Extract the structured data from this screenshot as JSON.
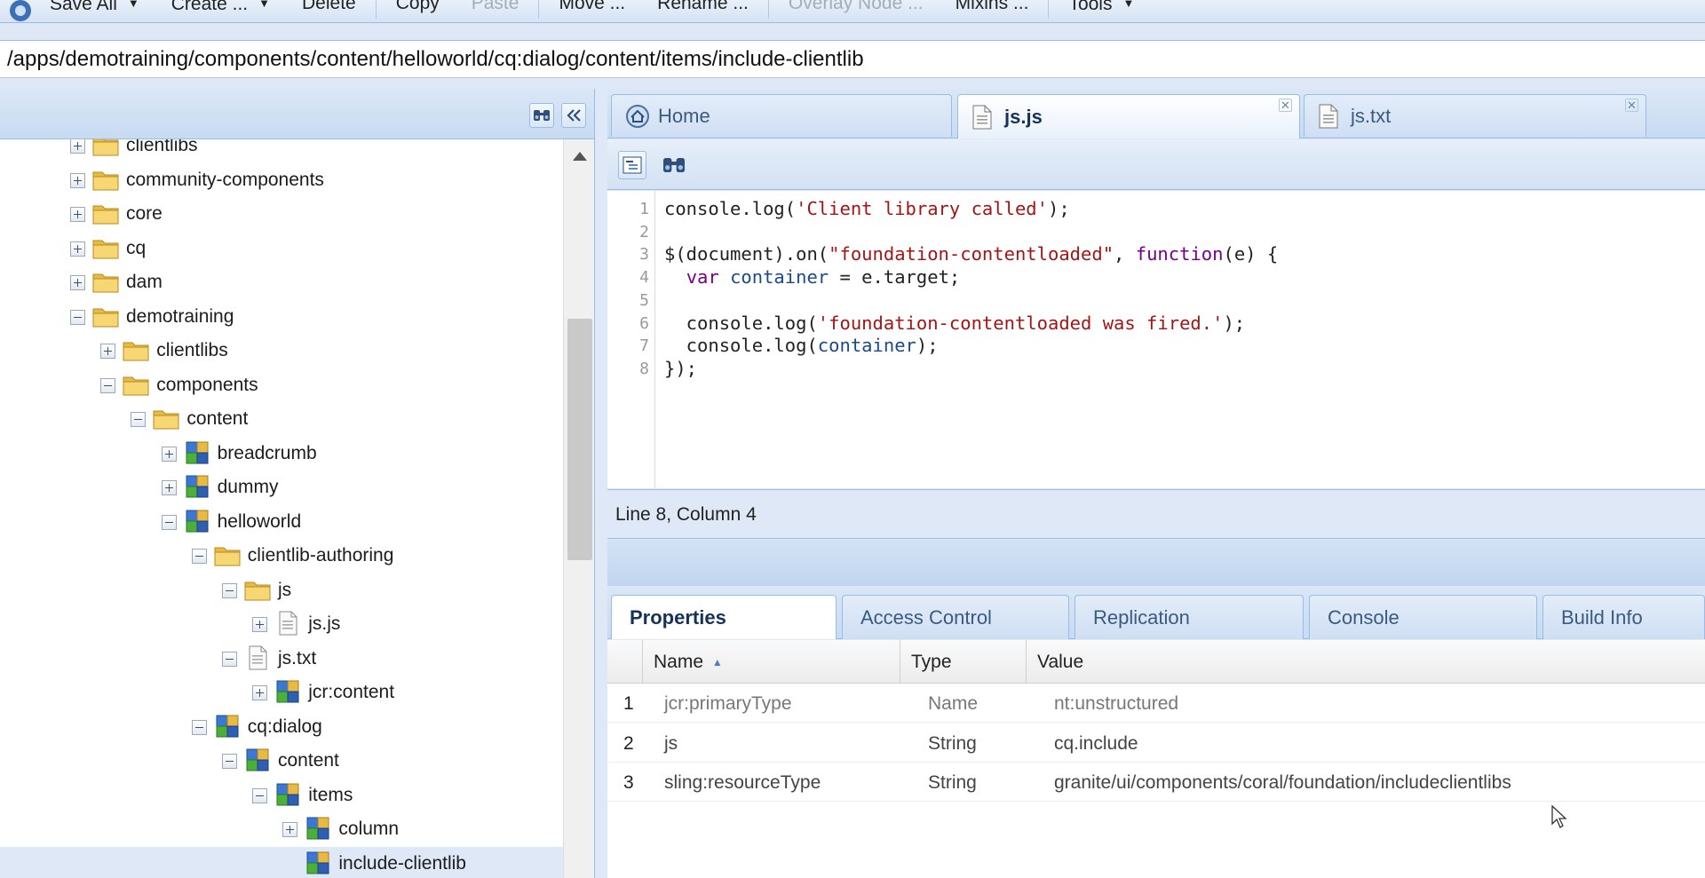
{
  "toolbar": {
    "buttons": [
      {
        "label": "Save All",
        "dropdown": true,
        "disabled": false
      },
      {
        "label": "Create ...",
        "dropdown": true,
        "disabled": false
      },
      {
        "label": "Delete",
        "dropdown": false,
        "disabled": false
      },
      {
        "label": "Copy",
        "dropdown": false,
        "disabled": false
      },
      {
        "label": "Paste",
        "dropdown": false,
        "disabled": true
      },
      {
        "label": "Move ...",
        "dropdown": false,
        "disabled": false
      },
      {
        "label": "Rename ...",
        "dropdown": false,
        "disabled": false
      },
      {
        "label": "Overlay Node ...",
        "dropdown": false,
        "disabled": true
      },
      {
        "label": "Mixins ...",
        "dropdown": false,
        "disabled": false
      },
      {
        "label": "Tools",
        "dropdown": true,
        "disabled": false
      }
    ]
  },
  "path": {
    "value": "/apps/demotraining/components/content/helloworld/cq:dialog/content/items/include-clientlib"
  },
  "tree": {
    "nodes": [
      {
        "label": "clientlibs",
        "depth": 0,
        "expander": "plus",
        "icon": "folder"
      },
      {
        "label": "community-components",
        "depth": 0,
        "expander": "plus",
        "icon": "folder"
      },
      {
        "label": "core",
        "depth": 0,
        "expander": "plus",
        "icon": "folder"
      },
      {
        "label": "cq",
        "depth": 0,
        "expander": "plus",
        "icon": "folder"
      },
      {
        "label": "dam",
        "depth": 0,
        "expander": "plus",
        "icon": "folder"
      },
      {
        "label": "demotraining",
        "depth": 0,
        "expander": "minus",
        "icon": "folder"
      },
      {
        "label": "clientlibs",
        "depth": 1,
        "expander": "plus",
        "icon": "folder"
      },
      {
        "label": "components",
        "depth": 1,
        "expander": "minus",
        "icon": "folder"
      },
      {
        "label": "content",
        "depth": 2,
        "expander": "minus",
        "icon": "folder"
      },
      {
        "label": "breadcrumb",
        "depth": 3,
        "expander": "plus",
        "icon": "component"
      },
      {
        "label": "dummy",
        "depth": 3,
        "expander": "plus",
        "icon": "component"
      },
      {
        "label": "helloworld",
        "depth": 3,
        "expander": "minus",
        "icon": "component"
      },
      {
        "label": "clientlib-authoring",
        "depth": 4,
        "expander": "minus",
        "icon": "folder"
      },
      {
        "label": "js",
        "depth": 5,
        "expander": "minus",
        "icon": "folder"
      },
      {
        "label": "js.js",
        "depth": 6,
        "expander": "plus",
        "icon": "file"
      },
      {
        "label": "js.txt",
        "depth": 5,
        "expander": "minus",
        "icon": "file"
      },
      {
        "label": "jcr:content",
        "depth": 6,
        "expander": "plus",
        "icon": "component"
      },
      {
        "label": "cq:dialog",
        "depth": 4,
        "expander": "minus",
        "icon": "component"
      },
      {
        "label": "content",
        "depth": 5,
        "expander": "minus",
        "icon": "component"
      },
      {
        "label": "items",
        "depth": 6,
        "expander": "minus",
        "icon": "component"
      },
      {
        "label": "column",
        "depth": 7,
        "expander": "plus",
        "icon": "component"
      },
      {
        "label": "include-clientlib",
        "depth": 7,
        "expander": "none",
        "icon": "component",
        "selected": true
      }
    ]
  },
  "editor": {
    "tabs": [
      {
        "label": "Home",
        "icon": "home-icon",
        "closable": false,
        "active": false
      },
      {
        "label": "js.js",
        "icon": "file-icon",
        "closable": true,
        "active": true
      },
      {
        "label": "js.txt",
        "icon": "file-icon",
        "closable": true,
        "active": false
      }
    ],
    "code": [
      [
        {
          "t": "console.log("
        },
        {
          "t": "'Client library called'",
          "c": "str"
        },
        {
          "t": ");"
        }
      ],
      [],
      [
        {
          "t": "$(document).on("
        },
        {
          "t": "\"foundation-contentloaded\"",
          "c": "str"
        },
        {
          "t": ", "
        },
        {
          "t": "function",
          "c": "kw"
        },
        {
          "t": "(e) {"
        }
      ],
      [
        {
          "t": "  "
        },
        {
          "t": "var",
          "c": "kw"
        },
        {
          "t": " "
        },
        {
          "t": "container",
          "c": "var"
        },
        {
          "t": " = e.target;"
        }
      ],
      [],
      [
        {
          "t": "  console.log("
        },
        {
          "t": "'foundation-contentloaded was fired.'",
          "c": "str"
        },
        {
          "t": ");"
        }
      ],
      [
        {
          "t": "  console.log("
        },
        {
          "t": "container",
          "c": "var"
        },
        {
          "t": ");"
        }
      ],
      [
        {
          "t": "});"
        }
      ]
    ],
    "status": "Line 8, Column 4"
  },
  "bottom": {
    "tabs": [
      {
        "label": "Properties",
        "active": true
      },
      {
        "label": "Access Control",
        "active": false
      },
      {
        "label": "Replication",
        "active": false
      },
      {
        "label": "Console",
        "active": false
      },
      {
        "label": "Build Info",
        "active": false
      }
    ],
    "grid": {
      "headers": {
        "name": "Name",
        "type": "Type",
        "value": "Value"
      },
      "sort_indicator": "▲",
      "rows": [
        {
          "num": "1",
          "name": "jcr:primaryType",
          "type": "Name",
          "value": "nt:unstructured",
          "dim": true
        },
        {
          "num": "2",
          "name": "js",
          "type": "String",
          "value": "cq.include",
          "dim": false
        },
        {
          "num": "3",
          "name": "sling:resourceType",
          "type": "String",
          "value": "granite/ui/components/coral/foundation/includeclientlibs",
          "dim": false
        }
      ]
    }
  }
}
